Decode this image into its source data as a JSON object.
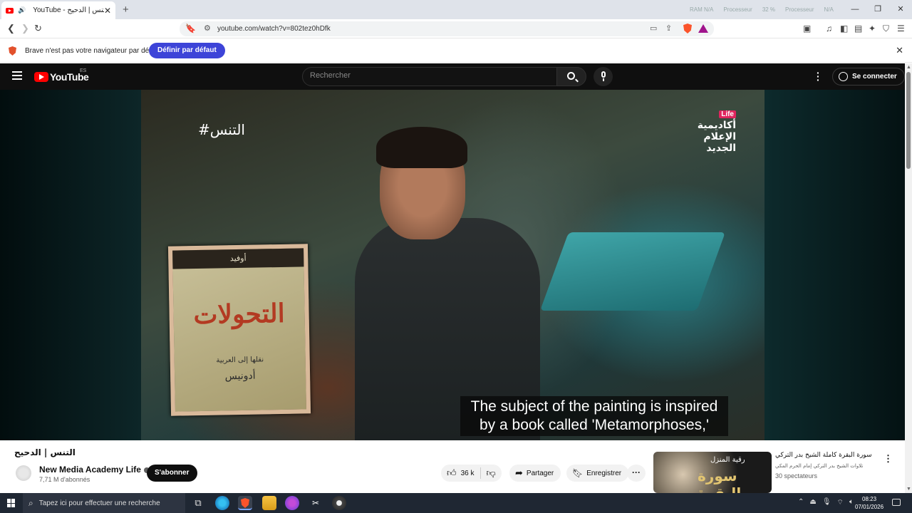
{
  "browser": {
    "tab_title": "YouTube - التنس | الدحيح",
    "tab_audio_icon": "speaker-icon",
    "new_tab_icon": "plus-icon",
    "system_overlay": [
      "RAM N/A",
      "Processeur",
      "32 %",
      "Processeur",
      "N/A"
    ],
    "window_controls": [
      "—",
      "❐",
      "✕"
    ],
    "url": "youtube.com/watch?v=802tez0hDfk",
    "infobar_message": "Brave n'est pas votre navigateur par défaut",
    "infobar_button": "Définir par défaut",
    "colors": {
      "brave_orange": "#fb542b",
      "infobar_button": "#3d44d8"
    }
  },
  "youtube": {
    "logo_text": "YouTube",
    "region": "ES",
    "search_placeholder": "Rechercher",
    "signin_label": "Se connecter",
    "accent": "#ff0000"
  },
  "video": {
    "hashtag": "#التنس",
    "channel_badge": "Life",
    "academy_logo_text": "أكاديمية الإعلام الجديد",
    "book_author_band": "أوفيد",
    "book_title": "التحولات",
    "book_subtitle": "نقلها إلى العربية",
    "book_translator": "أدونيس",
    "subtitle_line1": "The subject of the painting is inspired",
    "subtitle_line2": "by a book called 'Metamorphoses,'"
  },
  "meta": {
    "title": "التنس | الدحيح",
    "channel_name": "New Media Academy Life",
    "subscribers": "7,71 M d'abonnés",
    "subscribe_label": "S'abonner",
    "likes": "36 k",
    "share_label": "Partager",
    "save_label": "Enregistrer"
  },
  "recommendation": {
    "thumb_header": "رقية المنزل",
    "thumb_logo": "سورة البقرة",
    "title": "سورة البقرة كاملة  الشيخ بدر التركي",
    "channel": "تلاوات الشيخ بدر التركي إمام الحرم المكي",
    "viewers": "30 spectateurs"
  },
  "taskbar": {
    "search_placeholder": "Tapez ici pour effectuer une recherche",
    "time": "08:23",
    "date": "07/01/2026"
  }
}
